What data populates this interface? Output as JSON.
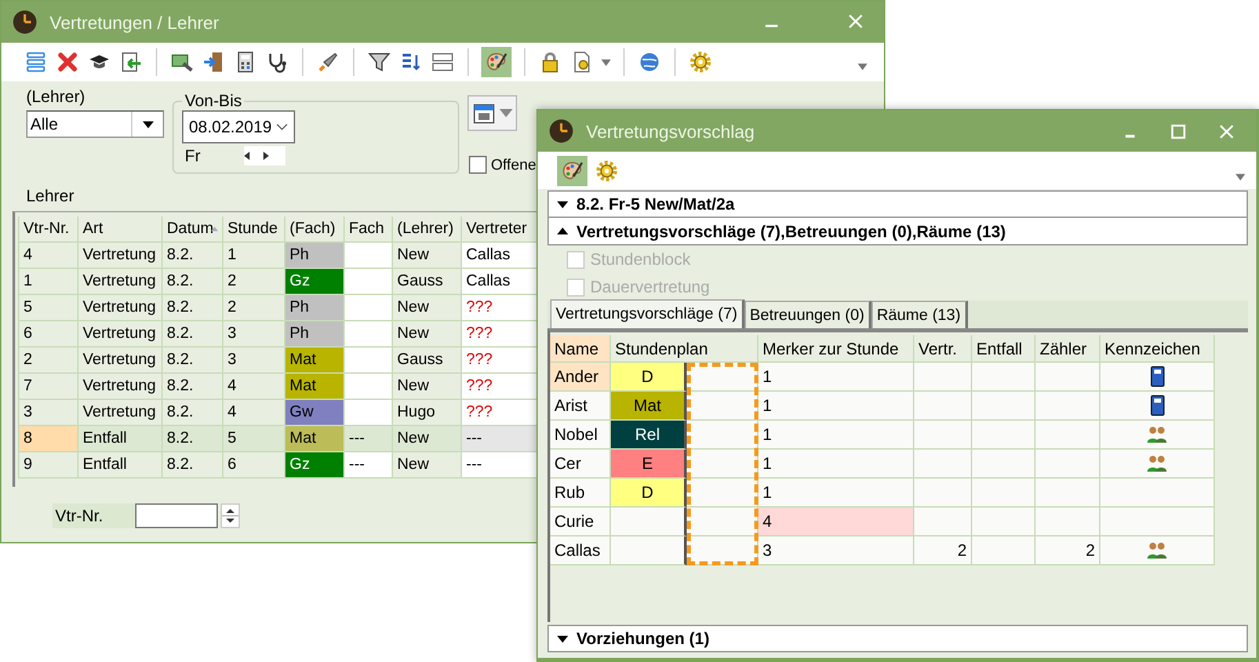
{
  "back_window": {
    "title": "Vertretungen / Lehrer",
    "toolbar": {
      "palette_pressed": true
    },
    "filter": {
      "label": "(Lehrer)",
      "value": "Alle",
      "group_label": "Von-Bis",
      "date": "08.02.2019",
      "weekday": "Fr",
      "checkbox": {
        "label": "Offene",
        "checked": false
      }
    },
    "table_label": "Lehrer",
    "table": {
      "columns": [
        {
          "label": "Vtr-Nr.",
          "sorted": false
        },
        {
          "label": "Art",
          "sorted": false
        },
        {
          "label": "Datum",
          "sorted": true
        },
        {
          "label": "Stunde",
          "sorted": false
        },
        {
          "label": "(Fach)",
          "sorted": false
        },
        {
          "label": "Fach",
          "sorted": false
        },
        {
          "label": "(Lehrer)",
          "sorted": false
        },
        {
          "label": "Vertreter",
          "sorted": false
        }
      ],
      "rows": [
        {
          "nr": "4",
          "art": "Vertretung",
          "datum": "8.2.",
          "stunde": "1",
          "fach_plan": "Ph",
          "color": "#c0c0c0",
          "lehrer": "New",
          "vertreter": "Callas",
          "unassigned": false,
          "selected": false
        },
        {
          "nr": "1",
          "art": "Vertretung",
          "datum": "8.2.",
          "stunde": "2",
          "fach_plan": "Gz",
          "color": "#008000",
          "lehrer": "Gauss",
          "vertreter": "Callas",
          "unassigned": false,
          "selected": false
        },
        {
          "nr": "5",
          "art": "Vertretung",
          "datum": "8.2.",
          "stunde": "2",
          "fach_plan": "Ph",
          "color": "#c0c0c0",
          "lehrer": "New",
          "vertreter": "???",
          "unassigned": true,
          "selected": false
        },
        {
          "nr": "6",
          "art": "Vertretung",
          "datum": "8.2.",
          "stunde": "3",
          "fach_plan": "Ph",
          "color": "#c0c0c0",
          "lehrer": "New",
          "vertreter": "???",
          "unassigned": true,
          "selected": false
        },
        {
          "nr": "2",
          "art": "Vertretung",
          "datum": "8.2.",
          "stunde": "3",
          "fach_plan": "Mat",
          "color": "#b8b400",
          "lehrer": "Gauss",
          "vertreter": "???",
          "unassigned": true,
          "selected": false
        },
        {
          "nr": "7",
          "art": "Vertretung",
          "datum": "8.2.",
          "stunde": "4",
          "fach_plan": "Mat",
          "color": "#b8b400",
          "lehrer": "New",
          "vertreter": "???",
          "unassigned": true,
          "selected": false
        },
        {
          "nr": "3",
          "art": "Vertretung",
          "datum": "8.2.",
          "stunde": "4",
          "fach_plan": "Gw",
          "color": "#8080c0",
          "lehrer": "Hugo",
          "vertreter": "???",
          "unassigned": true,
          "selected": false
        },
        {
          "nr": "8",
          "art": "Entfall",
          "datum": "8.2.",
          "stunde": "5",
          "fach_plan": "Mat",
          "color": "#bcbc58",
          "fach": "---",
          "lehrer": "New",
          "vertreter": "---",
          "unassigned": false,
          "selected": true
        },
        {
          "nr": "9",
          "art": "Entfall",
          "datum": "8.2.",
          "stunde": "6",
          "fach_plan": "Gz",
          "color": "#008000",
          "fach": "---",
          "lehrer": "New",
          "vertreter": "---",
          "unassigned": false,
          "selected": false
        }
      ]
    },
    "footer": {
      "label": "Vtr-Nr."
    }
  },
  "front_window": {
    "title": "Vertretungsvorschlag",
    "toolbar": {
      "palette_pressed": true
    },
    "sections": [
      {
        "title": "8.2. Fr-5 New/Mat/2a",
        "expanded": false
      },
      {
        "title": "Vertretungsvorschläge (7),Betreuungen (0),Räume (13)",
        "expanded": true
      }
    ],
    "options": [
      {
        "label": "Stundenblock",
        "checked": false,
        "disabled": true
      },
      {
        "label": "Dauervertretung",
        "checked": false,
        "disabled": true
      }
    ],
    "tabs": [
      {
        "label": "Vertretungsvorschläge (7)",
        "selected": true
      },
      {
        "label": "Betreuungen (0)",
        "selected": false
      },
      {
        "label": "Räume (13)",
        "selected": false
      }
    ],
    "table": {
      "slot_marked": true,
      "columns": [
        {
          "label": "Name",
          "highlighted": true
        },
        {
          "label": "Stundenplan",
          "highlighted": false
        },
        {
          "label": "Merker zur Stunde",
          "highlighted": false
        },
        {
          "label": "Vertr.",
          "highlighted": false
        },
        {
          "label": "Entfall",
          "highlighted": false
        },
        {
          "label": "Zähler",
          "highlighted": false
        },
        {
          "label": "Kennzeichen",
          "highlighted": false
        }
      ],
      "rows": [
        {
          "name": "Ander",
          "selected": true,
          "plan": "D",
          "color": "#ffff80",
          "merker": "1",
          "merker_flagged": false,
          "kind": "book"
        },
        {
          "name": "Arist",
          "selected": false,
          "plan": "Mat",
          "color": "#b8b400",
          "merker": "1",
          "merker_flagged": false,
          "kind": "book"
        },
        {
          "name": "Nobel",
          "selected": false,
          "plan": "Rel",
          "color": "#004040",
          "merker": "1",
          "merker_flagged": false,
          "kind": "people"
        },
        {
          "name": "Cer",
          "selected": false,
          "plan": "E",
          "color": "#ff8080",
          "merker": "1",
          "merker_flagged": false,
          "kind": "people"
        },
        {
          "name": "Rub",
          "selected": false,
          "plan": "D",
          "color": "#ffff80",
          "merker": "1",
          "merker_flagged": false
        },
        {
          "name": "Curie",
          "selected": false,
          "merker": "4",
          "merker_flagged": true
        },
        {
          "name": "Callas",
          "selected": false,
          "merker": "3",
          "merker_flagged": false,
          "vertr": "2",
          "zaehler": "2",
          "kind": "people"
        }
      ]
    },
    "bottom_section": {
      "title": "Vorziehungen (1)",
      "expanded": false
    }
  }
}
